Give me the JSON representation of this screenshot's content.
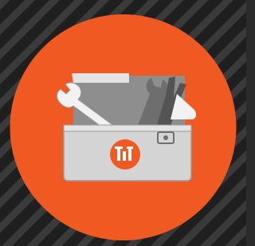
{
  "colors": {
    "background": "#2b2b2b",
    "stripe_dark": "#1f1f1f",
    "stripe_light": "#3a3a3a",
    "circle": "#f05a22",
    "toolbox_body": "#d4d4d4",
    "toolbox_lid": "#e3e3e3",
    "toolbox_outline": "#9a9a9a",
    "toolbox_inner": "#8e8e8e",
    "tool_white": "#f2f2f2",
    "tool_gray": "#6e6e6e",
    "tool_dark": "#545454",
    "badge": "#f05a22",
    "badge_mark": "#ffffff",
    "latch": "#6e6e6e"
  },
  "icons": {
    "background": "diagonal-stripes-pattern",
    "main": "toolbox-icon",
    "tools": [
      "wrench-icon",
      "adjustable-wrench-icon",
      "pliers-icon"
    ],
    "badge": "brand-logo-badge",
    "latch": "latch-icon"
  }
}
